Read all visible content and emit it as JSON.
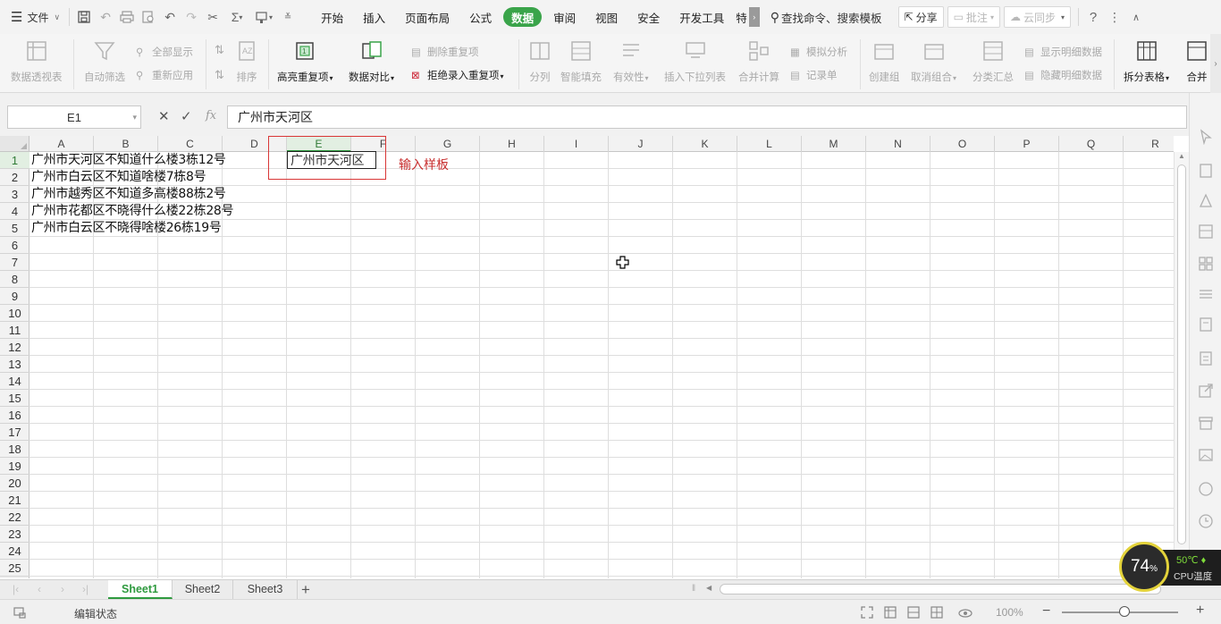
{
  "menubar": {
    "file_label": "文件",
    "tabs": [
      {
        "label": "开始"
      },
      {
        "label": "插入"
      },
      {
        "label": "页面布局"
      },
      {
        "label": "公式"
      },
      {
        "label": "数据",
        "active": true
      },
      {
        "label": "审阅"
      },
      {
        "label": "视图"
      },
      {
        "label": "安全"
      },
      {
        "label": "开发工具"
      },
      {
        "label": "特"
      }
    ],
    "search_label": "查找命令、搜索模板",
    "share_label": "分享",
    "comment_label": "批注",
    "cloud_sync_label": "云同步",
    "help_label": "?",
    "more_label": "⋮"
  },
  "ribbon": {
    "pivot": "数据透视表",
    "autofilter": "自动筛选",
    "show_all": "全部显示",
    "reapply": "重新应用",
    "sort": "排序",
    "highlight_dup": "高亮重复项",
    "data_compare": "数据对比",
    "remove_dup": "删除重复项",
    "reject_dup": "拒绝录入重复项",
    "split_col": "分列",
    "smart_fill": "智能填充",
    "validity": "有效性",
    "insert_dropdown": "插入下拉列表",
    "merge_calc": "合并计算",
    "simulate": "模拟分析",
    "record_sheet": "记录单",
    "create_group": "创建组",
    "ungroup": "取消组合",
    "subtotal": "分类汇总",
    "show_detail": "显示明细数据",
    "hide_detail": "隐藏明细数据",
    "split_table": "拆分表格",
    "merge_table": "合并"
  },
  "formula_bar": {
    "cell_ref": "E1",
    "fx_label": "fx",
    "content": "广州市天河区"
  },
  "grid": {
    "columns": [
      "A",
      "B",
      "C",
      "D",
      "E",
      "F",
      "G",
      "H",
      "I",
      "J",
      "K",
      "L",
      "M",
      "N",
      "O",
      "P",
      "Q",
      "R"
    ],
    "rows": [
      "1",
      "2",
      "3",
      "4",
      "5",
      "6",
      "7",
      "8",
      "9",
      "10",
      "11",
      "12",
      "13",
      "14",
      "15",
      "16",
      "17",
      "18",
      "19",
      "20",
      "21",
      "22",
      "23",
      "24",
      "25"
    ],
    "cells_a": [
      "广州市天河区不知道什么楼3栋12号",
      "广州市白云区不知道啥楼7栋8号",
      "广州市越秀区不知道多高楼88栋2号",
      "广州市花都区不晓得什么楼22栋28号",
      "广州市白云区不晓得啥楼26栋19号"
    ],
    "e1_value": "广州市天河区",
    "annotation": "输入样板"
  },
  "sheets": [
    {
      "label": "Sheet1",
      "active": true
    },
    {
      "label": "Sheet2"
    },
    {
      "label": "Sheet3"
    }
  ],
  "status_bar": {
    "mode": "编辑状态",
    "zoom": "100%"
  },
  "cpu_widget": {
    "usage": "74",
    "usage_unit": "%",
    "temp": "50℃",
    "label": "CPU温度"
  },
  "colors": {
    "accent": "#3aa44a",
    "annotation_red": "#c83030",
    "cpu_ring": "#e3d23a"
  }
}
